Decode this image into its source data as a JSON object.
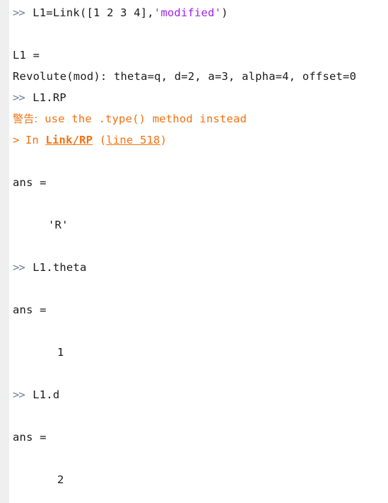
{
  "console": {
    "prompt_symbol": ">>",
    "warning_arrow": ">",
    "colors": {
      "background": "#ffffff",
      "gutter": "#efeff0",
      "text": "#1a1a1a",
      "prompt": "#6b7f99",
      "string": "#a020f0",
      "warning": "#f5700f",
      "link": "#f5700f"
    },
    "lines": [
      {
        "id": "cmd-link-construct",
        "type": "command",
        "prompt": ">>",
        "text": "L1=Link([1 2 3 4],",
        "string": "'modified'",
        "tail": ")"
      },
      {
        "id": "var-name-L1",
        "type": "output",
        "text": "L1 ="
      },
      {
        "id": "link-description",
        "type": "output",
        "text": "Revolute(mod): theta=q, d=2, a=3, alpha=4, offset=0"
      },
      {
        "id": "cmd-L1-RP",
        "type": "command",
        "prompt": ">>",
        "text": "L1.RP"
      },
      {
        "id": "warning-message",
        "type": "warning",
        "label": "警告:",
        "text": " use the .type() method instead"
      },
      {
        "id": "warning-trace",
        "type": "warning-trace",
        "arrow": ">",
        "prefix": " In ",
        "link": "Link/RP",
        "middle": " (",
        "link_line": "line 518",
        "suffix": ")"
      },
      {
        "id": "ans-label-1",
        "type": "output",
        "text": "ans ="
      },
      {
        "id": "ans-value-1",
        "type": "value",
        "text": "'R'"
      },
      {
        "id": "cmd-L1-theta",
        "type": "command",
        "prompt": ">>",
        "text": "L1.theta"
      },
      {
        "id": "ans-label-2",
        "type": "output",
        "text": "ans ="
      },
      {
        "id": "ans-value-2",
        "type": "value",
        "text": "1"
      },
      {
        "id": "cmd-L1-d",
        "type": "command",
        "prompt": ">>",
        "text": "L1.d"
      },
      {
        "id": "ans-label-3",
        "type": "output",
        "text": "ans ="
      },
      {
        "id": "ans-value-3",
        "type": "value",
        "text": "2"
      }
    ]
  }
}
